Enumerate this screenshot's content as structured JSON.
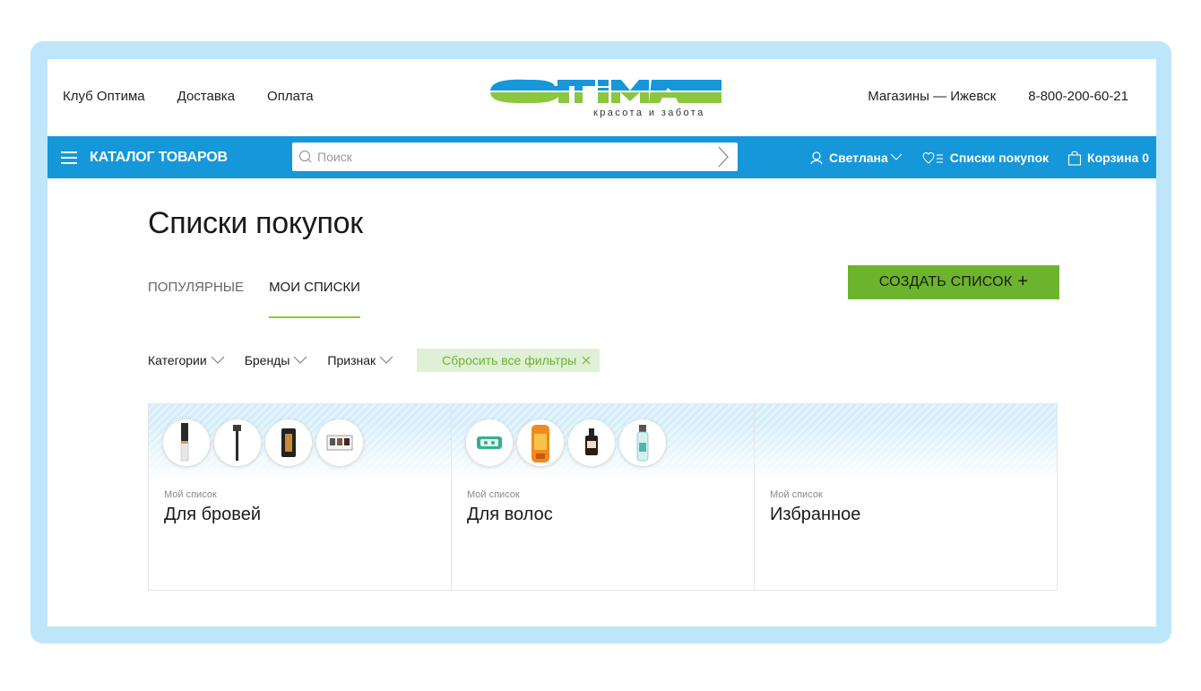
{
  "header": {
    "links": [
      "Клуб Оптима",
      "Доставка",
      "Оплата"
    ],
    "logo_text": "Оптима",
    "logo_sub": "красота и забота",
    "stores": "Магазины — Ижевск",
    "phone": "8-800-200-60-21",
    "brand_blue": "#1597d9",
    "brand_green": "#8cc63f"
  },
  "nav": {
    "catalog_label": "КАТАЛОГ ТОВАРОВ",
    "search_placeholder": "Поиск",
    "user_label": "Светлана",
    "lists_label": "Списки покупок",
    "cart_label": "Корзина 0"
  },
  "page": {
    "title": "Списки покупок",
    "tabs": [
      {
        "label": "ПОПУЛЯРНЫЕ",
        "active": false
      },
      {
        "label": "МОИ СПИСКИ",
        "active": true
      }
    ],
    "create_button": "СОЗДАТЬ СПИСОК",
    "filters": [
      "Категории",
      "Бренды",
      "Признак"
    ],
    "reset_filters": "Сбросить все фильтры"
  },
  "cards": [
    {
      "sub": "Мой список",
      "title": "Для бровей",
      "thumbs": [
        "brow-pencil-icon",
        "brow-brush-icon",
        "brow-cream-icon",
        "brow-palette-icon"
      ]
    },
    {
      "sub": "Мой список",
      "title": "Для волос",
      "thumbs": [
        "hair-clips-icon",
        "shampoo-bottle-icon",
        "hair-oil-icon",
        "hair-spray-icon"
      ]
    },
    {
      "sub": "Мой список",
      "title": "Избранное",
      "thumbs": []
    }
  ]
}
